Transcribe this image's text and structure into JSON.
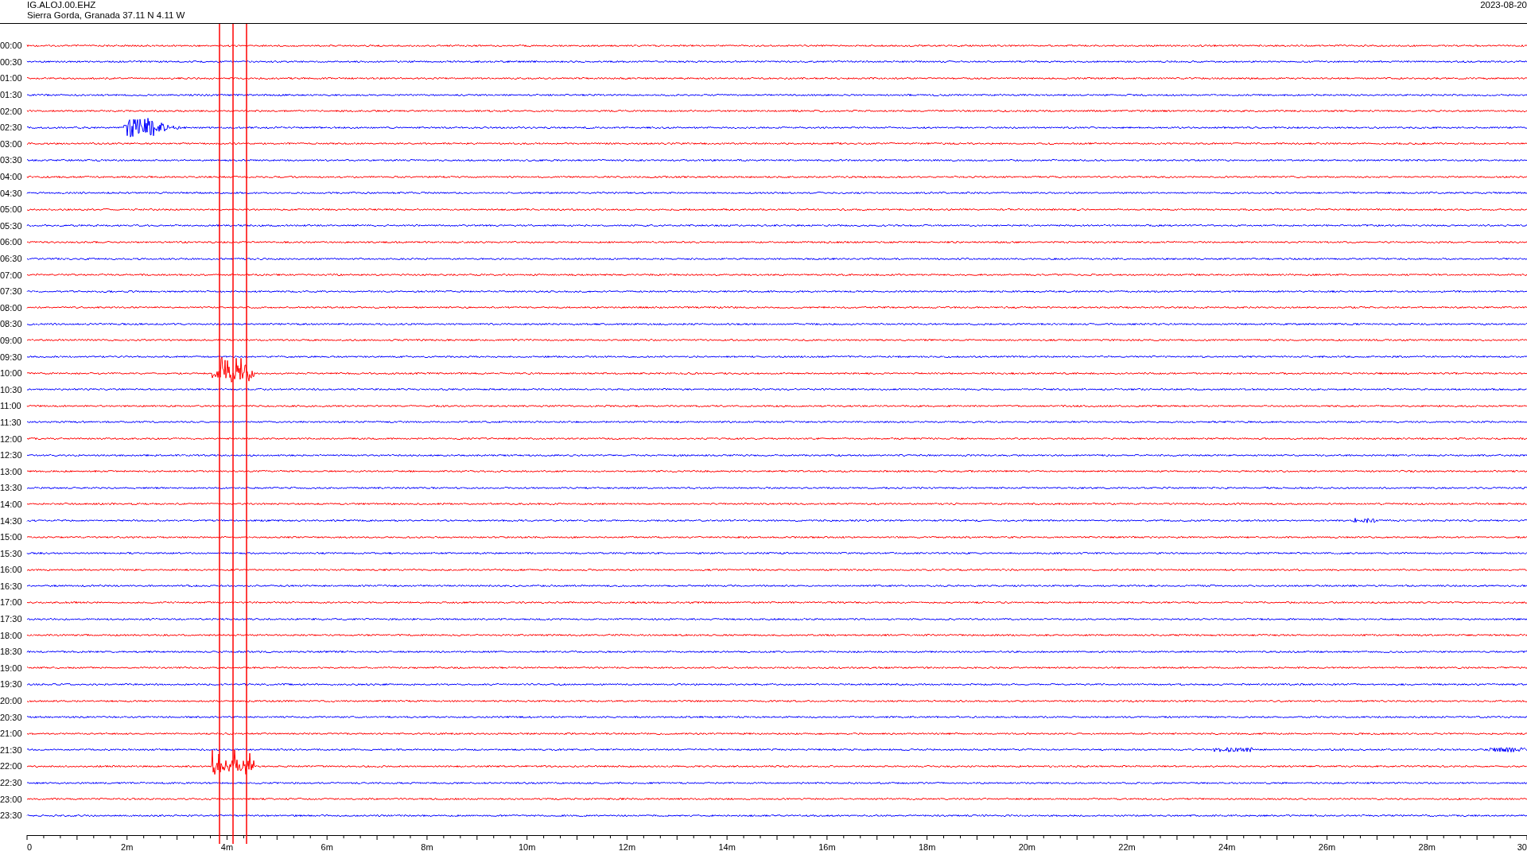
{
  "header": {
    "station": "IG.ALOJ.00.EHZ",
    "location": "Sierra Gorda, Granada  37.11 N 4.11 W",
    "date": "2023-08-20"
  },
  "rows": [
    {
      "time": "00:00",
      "color": "#ff0000"
    },
    {
      "time": "00:30",
      "color": "#0000ff"
    },
    {
      "time": "01:00",
      "color": "#ff0000"
    },
    {
      "time": "01:30",
      "color": "#0000ff"
    },
    {
      "time": "02:00",
      "color": "#ff0000"
    },
    {
      "time": "02:30",
      "color": "#0000ff"
    },
    {
      "time": "03:00",
      "color": "#ff0000"
    },
    {
      "time": "03:30",
      "color": "#0000ff"
    },
    {
      "time": "04:00",
      "color": "#ff0000"
    },
    {
      "time": "04:30",
      "color": "#0000ff"
    },
    {
      "time": "05:00",
      "color": "#ff0000"
    },
    {
      "time": "05:30",
      "color": "#0000ff"
    },
    {
      "time": "06:00",
      "color": "#ff0000"
    },
    {
      "time": "06:30",
      "color": "#0000ff"
    },
    {
      "time": "07:00",
      "color": "#ff0000"
    },
    {
      "time": "07:30",
      "color": "#0000ff"
    },
    {
      "time": "08:00",
      "color": "#ff0000"
    },
    {
      "time": "08:30",
      "color": "#0000ff"
    },
    {
      "time": "09:00",
      "color": "#ff0000"
    },
    {
      "time": "09:30",
      "color": "#0000ff"
    },
    {
      "time": "10:00",
      "color": "#ff0000"
    },
    {
      "time": "10:30",
      "color": "#0000ff"
    },
    {
      "time": "11:00",
      "color": "#ff0000"
    },
    {
      "time": "11:30",
      "color": "#0000ff"
    },
    {
      "time": "12:00",
      "color": "#ff0000"
    },
    {
      "time": "12:30",
      "color": "#0000ff"
    },
    {
      "time": "13:00",
      "color": "#ff0000"
    },
    {
      "time": "13:30",
      "color": "#0000ff"
    },
    {
      "time": "14:00",
      "color": "#ff0000"
    },
    {
      "time": "14:30",
      "color": "#0000ff"
    },
    {
      "time": "15:00",
      "color": "#ff0000"
    },
    {
      "time": "15:30",
      "color": "#0000ff"
    },
    {
      "time": "16:00",
      "color": "#ff0000"
    },
    {
      "time": "16:30",
      "color": "#0000ff"
    },
    {
      "time": "17:00",
      "color": "#ff0000"
    },
    {
      "time": "17:30",
      "color": "#0000ff"
    },
    {
      "time": "18:00",
      "color": "#ff0000"
    },
    {
      "time": "18:30",
      "color": "#0000ff"
    },
    {
      "time": "19:00",
      "color": "#ff0000"
    },
    {
      "time": "19:30",
      "color": "#0000ff"
    },
    {
      "time": "20:00",
      "color": "#ff0000"
    },
    {
      "time": "20:30",
      "color": "#0000ff"
    },
    {
      "time": "21:00",
      "color": "#ff0000"
    },
    {
      "time": "21:30",
      "color": "#0000ff"
    },
    {
      "time": "22:00",
      "color": "#ff0000"
    },
    {
      "time": "22:30",
      "color": "#0000ff"
    },
    {
      "time": "23:00",
      "color": "#ff0000"
    },
    {
      "time": "23:30",
      "color": "#0000ff"
    }
  ],
  "x_axis": {
    "labels": [
      "0",
      "2m",
      "4m",
      "6m",
      "8m",
      "10m",
      "12m",
      "14m",
      "16m",
      "18m",
      "20m",
      "22m",
      "24m",
      "26m",
      "28m",
      "30"
    ]
  }
}
